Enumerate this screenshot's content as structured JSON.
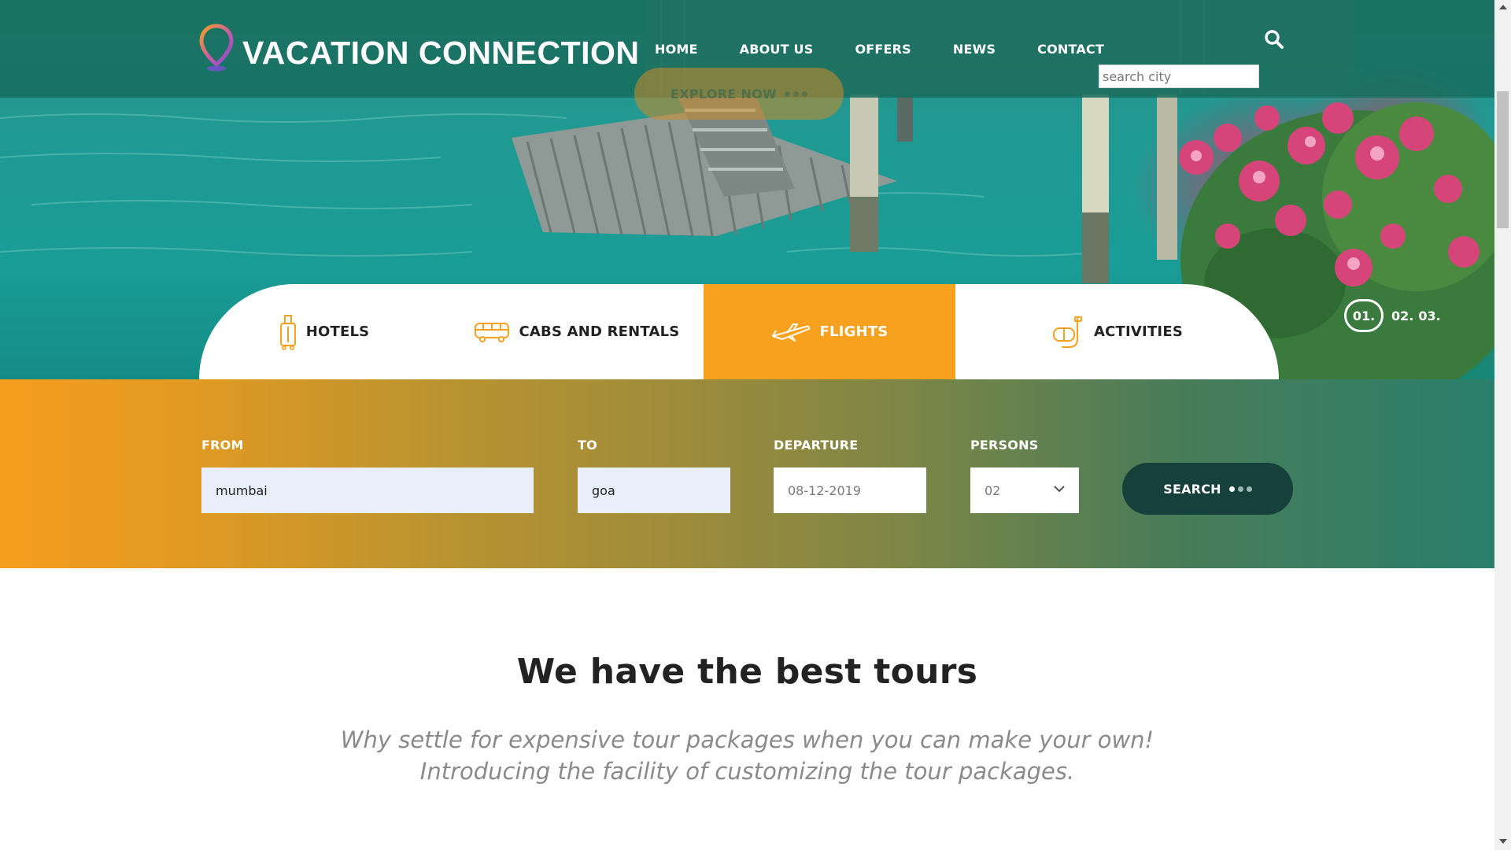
{
  "brand": {
    "name": "VACATION CONNECTION",
    "logo_icon": "location-pin-icon",
    "colors": {
      "accent": "#f8a11f",
      "dark": "#16403b",
      "teal": "#1f9a93"
    }
  },
  "nav": {
    "items": [
      {
        "label": "HOME"
      },
      {
        "label": "ABOUT US"
      },
      {
        "label": "OFFERS"
      },
      {
        "label": "NEWS"
      },
      {
        "label": "CONTACT"
      }
    ]
  },
  "header_search": {
    "icon": "search-icon",
    "placeholder": "search city",
    "value": ""
  },
  "hero": {
    "cta_label": "EXPLORE NOW",
    "slides": {
      "active": "01.",
      "others": [
        "02.",
        "03."
      ]
    }
  },
  "tabs": [
    {
      "label": "HOTELS",
      "icon": "luggage-icon",
      "active": false
    },
    {
      "label": "CABS AND RENTALS",
      "icon": "bus-icon",
      "active": false
    },
    {
      "label": "FLIGHTS",
      "icon": "airplane-icon",
      "active": true
    },
    {
      "label": "ACTIVITIES",
      "icon": "snorkel-mask-icon",
      "active": false
    }
  ],
  "search_form": {
    "from": {
      "label": "FROM",
      "value": "mumbai"
    },
    "to": {
      "label": "TO",
      "value": "goa"
    },
    "departure": {
      "label": "DEPARTURE",
      "value": "08-12-2019"
    },
    "persons": {
      "label": "PERSONS",
      "value": "02"
    },
    "submit_label": "SEARCH"
  },
  "content": {
    "heading": "We have the best tours",
    "subtext_line1": "Why settle for expensive tour packages when you can make your own!",
    "subtext_line2": "Introducing the facility of customizing the tour packages."
  }
}
